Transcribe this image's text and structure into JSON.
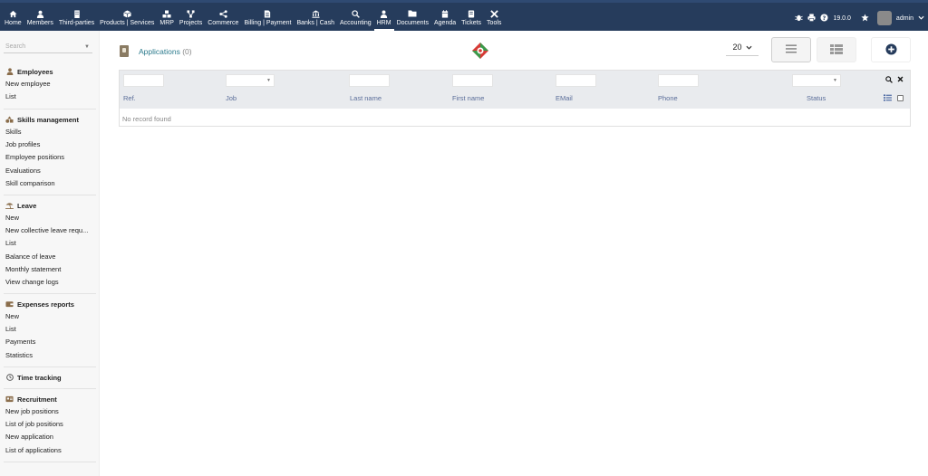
{
  "topbar": {
    "menu": [
      {
        "label": "Home",
        "icon": "home-icon"
      },
      {
        "label": "Members",
        "icon": "members-icon"
      },
      {
        "label": "Third-parties",
        "icon": "building-icon"
      },
      {
        "label": "Products | Services",
        "icon": "cube-icon"
      },
      {
        "label": "MRP",
        "icon": "cubes-icon"
      },
      {
        "label": "Projects",
        "icon": "sitemap-icon"
      },
      {
        "label": "Commerce",
        "icon": "share-icon"
      },
      {
        "label": "Billing | Payment",
        "icon": "invoice-icon"
      },
      {
        "label": "Banks | Cash",
        "icon": "bank-icon"
      },
      {
        "label": "Accounting",
        "icon": "search-dollar-icon"
      },
      {
        "label": "HRM",
        "icon": "user-tie-icon"
      },
      {
        "label": "Documents",
        "icon": "folder-icon"
      },
      {
        "label": "Agenda",
        "icon": "calendar-icon"
      },
      {
        "label": "Tickets",
        "icon": "ticket-icon"
      },
      {
        "label": "Tools",
        "icon": "tools-icon"
      }
    ],
    "active_menu": "HRM",
    "version": "19.0.0",
    "user": "admin"
  },
  "sidebar": {
    "search_placeholder": "Search",
    "sections": [
      {
        "title": "Employees",
        "icon": "user-icon",
        "links": [
          "New employee",
          "List"
        ]
      },
      {
        "title": "Skills management",
        "icon": "shapes-icon",
        "links": [
          "Skills",
          "Job profiles",
          "Employee positions",
          "Evaluations",
          "Skill comparison"
        ]
      },
      {
        "title": "Leave",
        "icon": "umbrella-beach-icon",
        "links": [
          "New",
          "New collective leave requ...",
          "List",
          "Balance of leave",
          "Monthly statement",
          "View change logs"
        ]
      },
      {
        "title": "Expenses reports",
        "icon": "wallet-icon",
        "links": [
          "New",
          "List",
          "Payments",
          "Statistics"
        ]
      },
      {
        "title": "Time tracking",
        "icon": "clock-icon",
        "links": []
      },
      {
        "title": "Recruitment",
        "icon": "id-badge-icon",
        "links": [
          "New job positions",
          "List of job positions",
          "New application",
          "List of applications"
        ]
      }
    ]
  },
  "main": {
    "title": "Applications",
    "count": "(0)",
    "page_size": "20",
    "columns": [
      "Ref.",
      "Job",
      "Last name",
      "First name",
      "EMail",
      "Phone",
      "Status"
    ],
    "empty_message": "No record found"
  },
  "colors": {
    "topbar_bg": "#263c5c",
    "link_title": "#2b7a8c",
    "column_header": "#5a6d99",
    "new_button": "#263c5c"
  }
}
